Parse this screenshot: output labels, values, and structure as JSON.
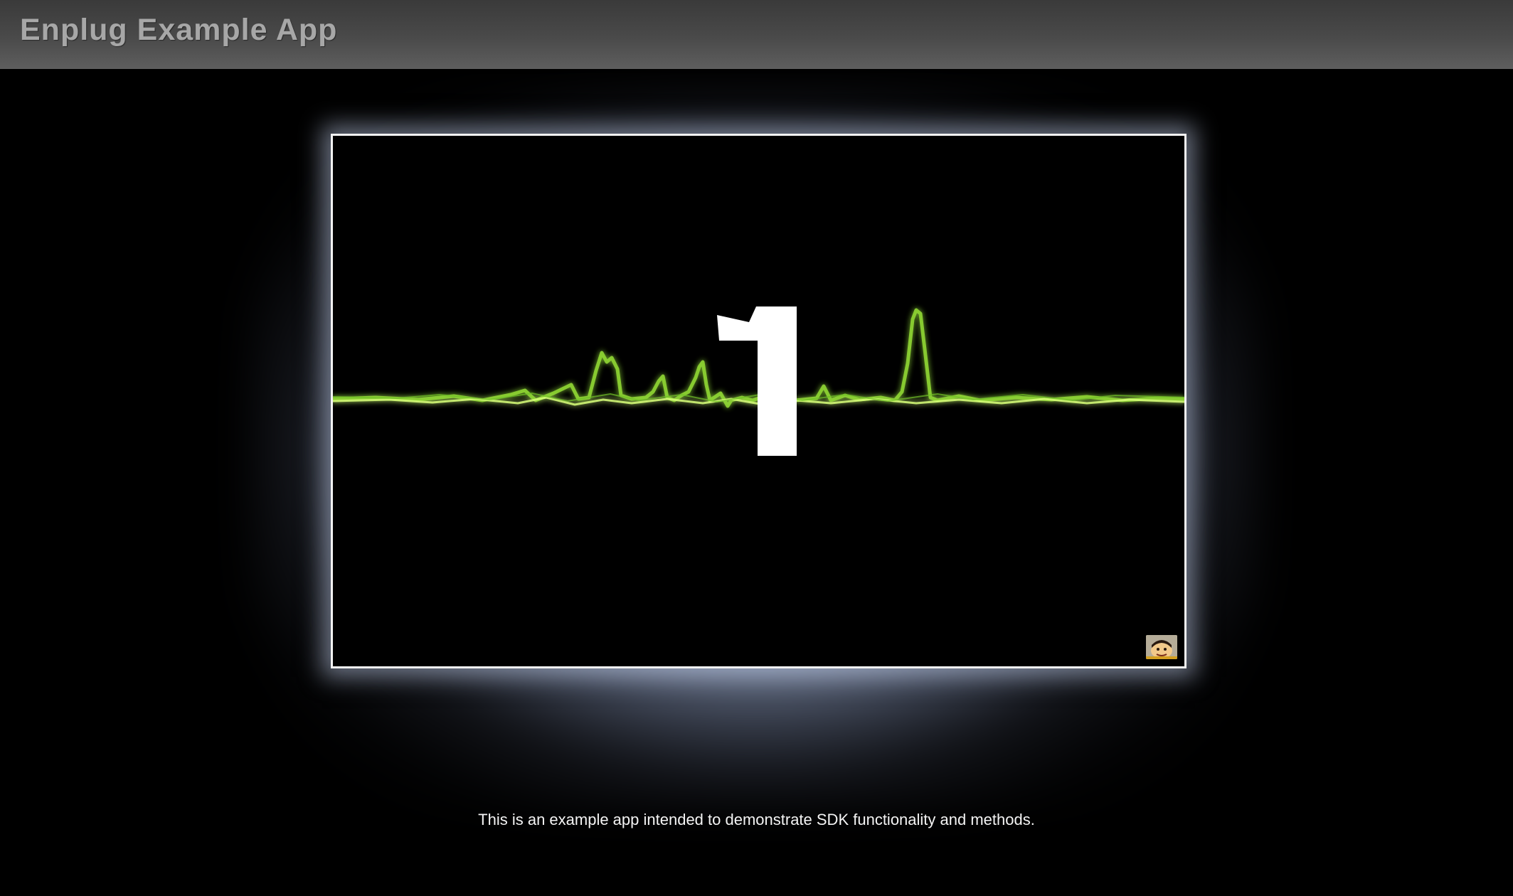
{
  "app": {
    "title": "Enplug Example App"
  },
  "video": {
    "countdown_number": "1",
    "channel_logo_icon": "cartoon-face-icon",
    "waveform_color": "#9ee03a"
  },
  "footer": {
    "caption": "This is an example app intended to demonstrate SDK functionality and methods."
  },
  "colors": {
    "header_text": "#a7a7a7",
    "glow": "#c8d4ec",
    "frame_border": "#f2f2f2",
    "caption_text": "#f4f4f4"
  }
}
